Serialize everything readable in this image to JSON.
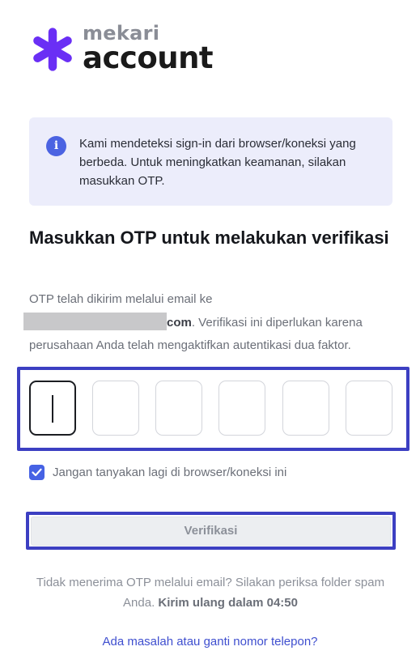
{
  "brand": {
    "top_word": "mekari",
    "main_word": "account",
    "mark_color": "#6a2ff5"
  },
  "notice": {
    "icon": "info-icon",
    "icon_glyph": "i",
    "text": "Kami mendeteksi sign-in dari browser/koneksi yang berbeda. Untuk meningkatkan keamanan, silakan masukkan OTP."
  },
  "heading": "Masukkan OTP untuk melakukan verifikasi",
  "description": {
    "prefix": "OTP telah dikirim melalui email ke",
    "email_visible_tail": "com",
    "suffix": ". Verifikasi ini diperlukan karena perusahaan Anda telah mengaktifkan autentikasi dua faktor."
  },
  "otp": {
    "digits": [
      "",
      "",
      "",
      "",
      "",
      ""
    ],
    "active_index": 0
  },
  "remember": {
    "checked": true,
    "label": "Jangan tanyakan lagi di browser/koneksi ini"
  },
  "verify_button": {
    "label": "Verifikasi",
    "disabled": true
  },
  "resend": {
    "text": "Tidak menerima OTP melalui email? Silakan periksa folder spam Anda.",
    "timer": "Kirim ulang dalam 04:50"
  },
  "help_link": "Ada masalah atau ganti nomor telepon?",
  "colors": {
    "accent": "#4662e4",
    "highlight_frame": "#3c3fc2",
    "link": "#3f4fcf"
  }
}
